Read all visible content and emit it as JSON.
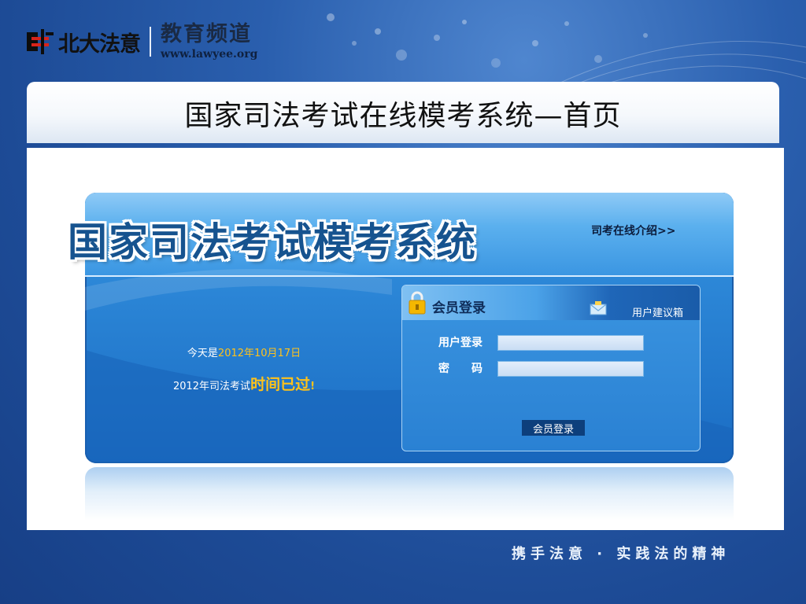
{
  "header": {
    "brand_logo_text": "北大法意",
    "channel_name": "教育频道",
    "channel_url": "www.lawyee.org"
  },
  "title_bar": {
    "title": "国家司法考试在线模考系统—首页"
  },
  "main": {
    "system_title": "国家司法考试模考系统",
    "intro_link": "司考在线介绍>>",
    "today_prefix": "今天是",
    "today_date": "2012年10月17日",
    "exam_prefix": "2012年司法考试",
    "exam_status": "时间已过",
    "exam_suffix": "!"
  },
  "login": {
    "title": "会员登录",
    "suggestion_link": "用户建议箱",
    "username_label": "用户登录",
    "password_label": "密　　码",
    "username_value": "",
    "password_value": "",
    "submit_label": "会员登录"
  },
  "footer": {
    "slogan": "携手法意 · 实践法的精神"
  },
  "colors": {
    "background": "#1f4f9c",
    "frame_blue": "#2d88d8",
    "highlight_yellow": "#ffc21a",
    "title_text": "#16538f"
  },
  "icons": [
    "lock-icon",
    "mail-icon",
    "logo-mark-icon"
  ]
}
